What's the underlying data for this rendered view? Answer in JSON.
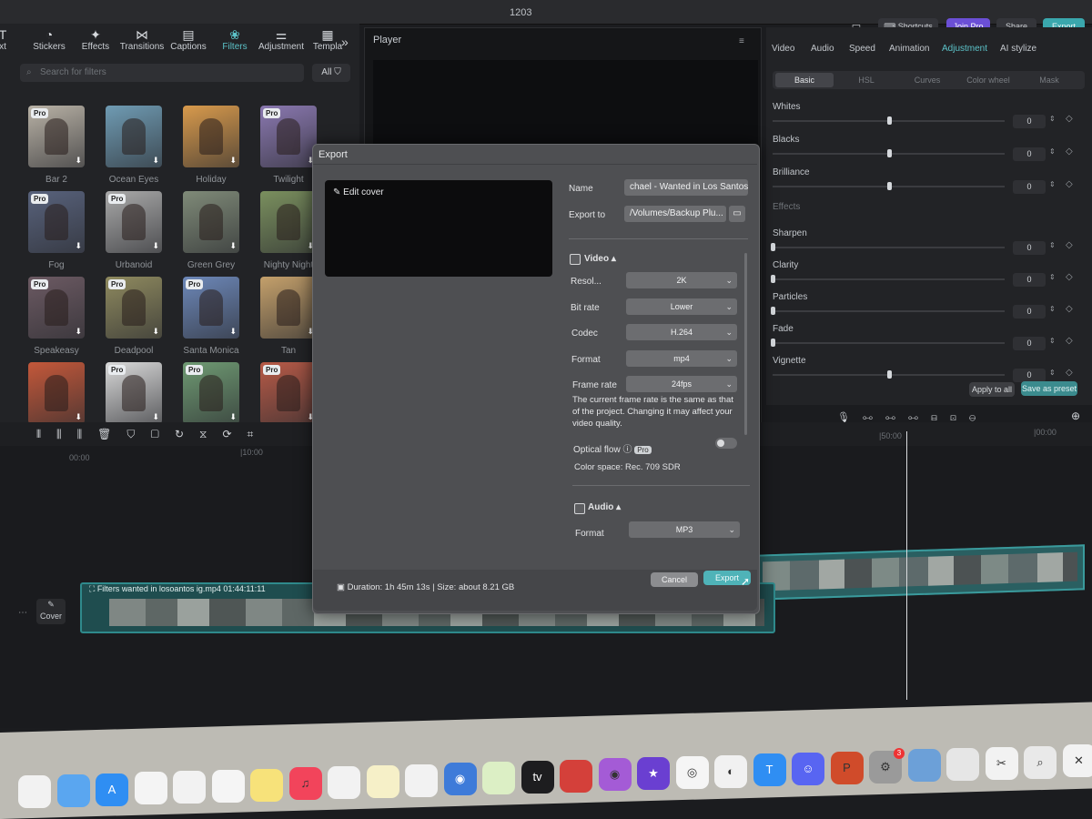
{
  "window": {
    "title": "1203"
  },
  "topbar": {
    "shortcuts_label": "Shortcuts",
    "join_pro_label": "Join Pro",
    "share_label": "Share",
    "export_label": "Export"
  },
  "toolbar": {
    "tools": [
      {
        "label": "xt",
        "icon": "text-icon"
      },
      {
        "label": "Stickers",
        "icon": "sticker-icon"
      },
      {
        "label": "Effects",
        "icon": "effects-icon"
      },
      {
        "label": "Transitions",
        "icon": "transition-icon"
      },
      {
        "label": "Captions",
        "icon": "captions-icon"
      },
      {
        "label": "Filters",
        "icon": "filters-icon"
      },
      {
        "label": "Adjustment",
        "icon": "adjustment-icon"
      },
      {
        "label": "Templa",
        "icon": "template-icon"
      }
    ],
    "active": "Filters"
  },
  "filters": {
    "search_placeholder": "Search for filters",
    "all_label": "All",
    "items": [
      {
        "name": "Bar 2",
        "pro": "Pro",
        "color": "#b9b2a6"
      },
      {
        "name": "Ocean Eyes",
        "pro": "",
        "color": "#6f9bb3"
      },
      {
        "name": "Holiday",
        "pro": "",
        "color": "#d89a4c"
      },
      {
        "name": "Twilight",
        "pro": "Pro",
        "color": "#8a78b0"
      },
      {
        "name": "Fog",
        "pro": "Pro",
        "color": "#58627c"
      },
      {
        "name": "Urbanoid",
        "pro": "Pro",
        "color": "#a9a9a9"
      },
      {
        "name": "Green Grey",
        "pro": "",
        "color": "#7f8a78"
      },
      {
        "name": "Nighty Night",
        "pro": "",
        "color": "#7a8f5e"
      },
      {
        "name": "Speakeasy",
        "pro": "Pro",
        "color": "#6c5a63"
      },
      {
        "name": "Deadpool",
        "pro": "Pro",
        "color": "#8f8a5f"
      },
      {
        "name": "Santa Monica",
        "pro": "Pro",
        "color": "#6d88b9"
      },
      {
        "name": "Tan",
        "pro": "",
        "color": "#c4a06b"
      },
      {
        "name": "",
        "pro": "",
        "color": "#c4583a"
      },
      {
        "name": "",
        "pro": "Pro",
        "color": "#d9d9d9"
      },
      {
        "name": "",
        "pro": "Pro",
        "color": "#6f9a73"
      },
      {
        "name": "",
        "pro": "Pro",
        "color": "#b75a47"
      }
    ]
  },
  "player": {
    "label": "Player"
  },
  "right_panel": {
    "tabs": [
      "Video",
      "Audio",
      "Speed",
      "Animation",
      "Adjustment",
      "AI stylize"
    ],
    "active_tab": "Adjustment",
    "subtabs": [
      "Basic",
      "HSL",
      "Curves",
      "Color wheel",
      "Mask"
    ],
    "rows": [
      {
        "label": "Whites",
        "value": "0",
        "level": 0.5
      },
      {
        "label": "Blacks",
        "value": "0",
        "level": 0.5
      },
      {
        "label": "Brilliance",
        "value": "0",
        "level": 0.5
      },
      {
        "label": "Effects",
        "value": "",
        "level": null
      },
      {
        "label": "Sharpen",
        "value": "0",
        "level": 0.0
      },
      {
        "label": "Clarity",
        "value": "0",
        "level": 0.0
      },
      {
        "label": "Particles",
        "value": "0",
        "level": 0.0
      },
      {
        "label": "Fade",
        "value": "0",
        "level": 0.0
      },
      {
        "label": "Vignette",
        "value": "0",
        "level": 0.5
      }
    ],
    "apply_all_label": "Apply to all",
    "save_preset_label": "Save as preset"
  },
  "timeline": {
    "ruler": [
      "00:00",
      "|10:00",
      "|50:00",
      "|00:00"
    ],
    "clip_label": "Filters  wanted in losoantos ig.mp4  01:44:11:11",
    "cover_label": "Cover"
  },
  "export_dialog": {
    "title": "Export",
    "edit_cover_label": "Edit cover",
    "name_label": "Name",
    "name_value": "chael - Wanted in Los Santos",
    "export_to_label": "Export to",
    "export_to_value": "/Volumes/Backup Plu...",
    "video_section": "Video",
    "resolution_label": "Resol...",
    "resolution_value": "2K",
    "bitrate_label": "Bit rate",
    "bitrate_value": "Lower",
    "codec_label": "Codec",
    "codec_value": "H.264",
    "format_label": "Format",
    "format_value": "mp4",
    "framerate_label": "Frame rate",
    "framerate_value": "24fps",
    "framerate_note": "The current frame rate is the same as that of the project. Changing it may affect your video quality.",
    "optical_flow_label": "Optical flow",
    "optical_flow_badge": "Pro",
    "color_space": "Color space: Rec. 709 SDR",
    "audio_section": "Audio",
    "audio_format_label": "Format",
    "audio_format_value": "MP3",
    "duration_size": "Duration: 1h 45m 13s | Size: about 8.21 GB",
    "cancel_label": "Cancel",
    "export_label": "Export"
  },
  "dock": {
    "apps": [
      {
        "icon": "calendar-icon",
        "color": "#f2f2f2"
      },
      {
        "icon": "finder-icon",
        "color": "#5aa6f0"
      },
      {
        "icon": "app-store-icon",
        "color": "#2f8ef3"
      },
      {
        "icon": "reminders-icon",
        "color": "#f4f4f4"
      },
      {
        "icon": "freeform-icon",
        "color": "#f2f2f2"
      },
      {
        "icon": "photos-icon",
        "color": "#f5f5f5"
      },
      {
        "icon": "notes-icon",
        "color": "#f7e27a"
      },
      {
        "icon": "music-icon",
        "color": "#f2445b"
      },
      {
        "icon": "news-icon",
        "color": "#f2f2f2"
      },
      {
        "icon": "stickies-icon",
        "color": "#f6f0c8"
      },
      {
        "icon": "freeform2-icon",
        "color": "#f2f2f2"
      },
      {
        "icon": "siri-icon",
        "color": "#3e7bd9"
      },
      {
        "icon": "maps-icon",
        "color": "#dcefc5"
      },
      {
        "icon": "apple-tv-icon",
        "color": "#1d1d1f"
      },
      {
        "icon": "photo-booth-icon",
        "color": "#d4403a"
      },
      {
        "icon": "podcasts-icon",
        "color": "#a45bd6"
      },
      {
        "icon": "imovie-icon",
        "color": "#6a3fd1"
      },
      {
        "icon": "chrome-icon",
        "color": "#f5f5f5"
      },
      {
        "icon": "blender-icon",
        "color": "#f1f1f1"
      },
      {
        "icon": "keynote-icon",
        "color": "#2f8ef3"
      },
      {
        "icon": "discord-icon",
        "color": "#5865f2"
      },
      {
        "icon": "powerpoint-icon",
        "color": "#d04b2a"
      },
      {
        "icon": "system-settings-icon",
        "color": "#9a9a9a"
      },
      {
        "icon": "preview-icon",
        "color": "#6ca0d8"
      },
      {
        "icon": "roblox-icon",
        "color": "#e6e6e6"
      },
      {
        "icon": "capcut-icon",
        "color": "#f2f2f2"
      },
      {
        "icon": "search-icon",
        "color": "#e9e9e9"
      },
      {
        "icon": "close-icon",
        "color": "#f2f2f2"
      }
    ],
    "settings_badge": "3"
  },
  "colors": {
    "accent": "#5cc3c9",
    "dialog_bg": "#4e4f52",
    "export_btn": "#4fb3b8"
  }
}
